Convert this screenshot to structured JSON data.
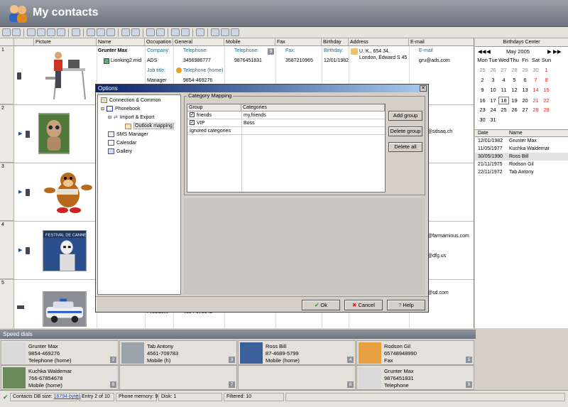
{
  "window": {
    "title": "My contacts"
  },
  "grid": {
    "columns": [
      "Picture",
      "Name",
      "Occupation",
      "General",
      "Mobile",
      "Fax",
      "Birthday",
      "Address",
      "E-mail"
    ],
    "rows": [
      {
        "num": "1",
        "name": "Grunter Max",
        "file": "Lionking2.mid",
        "company_label": "Company:",
        "company": "ADS",
        "jobtitle_label": "Job title:",
        "jobtitle": "Manager",
        "tel_label": "Telephone:",
        "tel": "3456986777",
        "telhome_label": "Telephone (home)",
        "telhome": "9854-469276",
        "mobile_label": "Telephone:",
        "mobile": "9876451831",
        "mobile_badge": "9",
        "fax_label": "Fax:",
        "fax": "3587210965",
        "bday_label": "Birthday:",
        "bday": "12/01/1982",
        "address": "U. K., 654 34, London, Edward S 45",
        "email_label": "E-mail",
        "email": "gru@ads.com"
      },
      {
        "num": "2",
        "email_frag": "@sdsaq.ch"
      },
      {
        "num": "3"
      },
      {
        "num": "4",
        "email_frag": "@farmaminus.com",
        "email_frag2": "@dfg.us"
      },
      {
        "num": "5",
        "email_frag": "@sd.com",
        "occ_frag": "President",
        "tel_frag": "4354-673542"
      }
    ]
  },
  "calendar": {
    "header": "Birthdays Center",
    "month": "May 2005",
    "days": [
      "Mon",
      "Tue",
      "Wed",
      "Thu",
      "Fri",
      "Sat",
      "Sun"
    ],
    "weeks": [
      [
        "25",
        "26",
        "27",
        "28",
        "29",
        "30",
        "1"
      ],
      [
        "2",
        "3",
        "4",
        "5",
        "6",
        "7",
        "8"
      ],
      [
        "9",
        "10",
        "11",
        "12",
        "13",
        "14",
        "15"
      ],
      [
        "16",
        "17",
        "18",
        "19",
        "20",
        "21",
        "22"
      ],
      [
        "23",
        "24",
        "25",
        "26",
        "27",
        "28",
        "29"
      ],
      [
        "30",
        "31",
        "",
        "",
        "",
        "",
        ""
      ]
    ],
    "table_headers": [
      "Date",
      "Name"
    ],
    "birthdays": [
      {
        "date": "12/01/1982",
        "name": "Grunter Max"
      },
      {
        "date": "11/05/1977",
        "name": "Kuchka Waldemar"
      },
      {
        "date": "30/05/1990",
        "name": "Ross Bill"
      },
      {
        "date": "21/11/1975",
        "name": "Rodson Gil"
      },
      {
        "date": "22/11/1972",
        "name": "Tab Antony"
      }
    ]
  },
  "speed_dials": {
    "header": "Speed dials",
    "items": [
      {
        "name": "Grunter Max",
        "phone": "9854-469276",
        "type": "Telephone (home)",
        "n": "2"
      },
      {
        "name": "Tab Antony",
        "phone": "4561-709783",
        "type": "Mobile (h)",
        "n": "3"
      },
      {
        "name": "Ross Bill",
        "phone": "87-4689-5799",
        "type": "Mobile (home)",
        "n": "4"
      },
      {
        "name": "Rodson Gil",
        "phone": "65748948990",
        "type": "Fax",
        "n": "5"
      },
      {
        "name": "Kuchka Waldemar",
        "phone": "766-67854678",
        "type": "Mobile (home)",
        "n": "6"
      },
      {
        "name": "",
        "phone": "",
        "type": "",
        "n": "7"
      },
      {
        "name": "",
        "phone": "",
        "type": "",
        "n": "8"
      },
      {
        "name": "Grunter Max",
        "phone": "9876451831",
        "type": "Telephone",
        "n": "9"
      }
    ]
  },
  "status": {
    "db_label": "Contacts DB size:",
    "db_size": "16794 bytes",
    "entry_label": "Entry",
    "entry": "2",
    "entry_of": "of",
    "entry_total": "10",
    "phone_mem_label": "Phone memory:",
    "phone_mem": "9",
    "disk_label": "Disk:",
    "disk": "1",
    "filtered_label": "Filtered:",
    "filtered": "10"
  },
  "dialog": {
    "title": "Options",
    "close": "✕",
    "tree": [
      "Connection & Common",
      "Phonebook",
      "Import & Export",
      "Outlook mapping",
      "SMS Manager",
      "Calendar",
      "Gallery"
    ],
    "group_caption": "Category Mapping",
    "table_headers": [
      "Group",
      "Categories"
    ],
    "mappings": [
      {
        "group": "friends",
        "categories": "my,friends"
      },
      {
        "group": "VIP",
        "categories": "Boss"
      }
    ],
    "ignored": "Ignored categories",
    "add_group": "Add group",
    "delete_group": "Delete group",
    "delete_all": "Delete all",
    "ok": "Ok",
    "cancel": "Cancel",
    "help": "Help"
  },
  "colors": {
    "accent": "#0a246a",
    "weekend": "#dd2222",
    "label": "#1b6a8a"
  }
}
